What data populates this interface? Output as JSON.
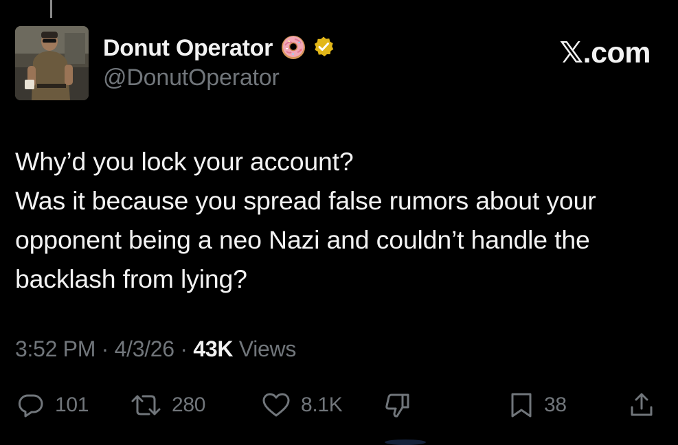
{
  "header": {
    "display_name": "Donut Operator",
    "handle": "@DonutOperator",
    "site": "𝕏.com",
    "icons": [
      "donut-icon",
      "verified-badge-icon"
    ]
  },
  "tweet": {
    "lines": [
      "Why’d you lock your account?",
      "Was it because you spread false rumors about your",
      "opponent being a neo Nazi and couldn’t handle the",
      "backlash from lying?"
    ]
  },
  "meta": {
    "time": "3:52 PM",
    "sep1": " · ",
    "date": "4/3/26",
    "sep2": " · ",
    "views_count": "43K",
    "views_label": " Views"
  },
  "actions": {
    "replies": "101",
    "reposts": "280",
    "likes": "8.1K",
    "bookmarks": "38",
    "icons": [
      "reply-icon",
      "repost-icon",
      "like-icon",
      "dislike-icon",
      "bookmark-icon",
      "share-icon"
    ]
  },
  "colors": {
    "background": "#000000",
    "text": "#f2f2f2",
    "secondary": "#71767b",
    "verified": "#e2b719"
  }
}
